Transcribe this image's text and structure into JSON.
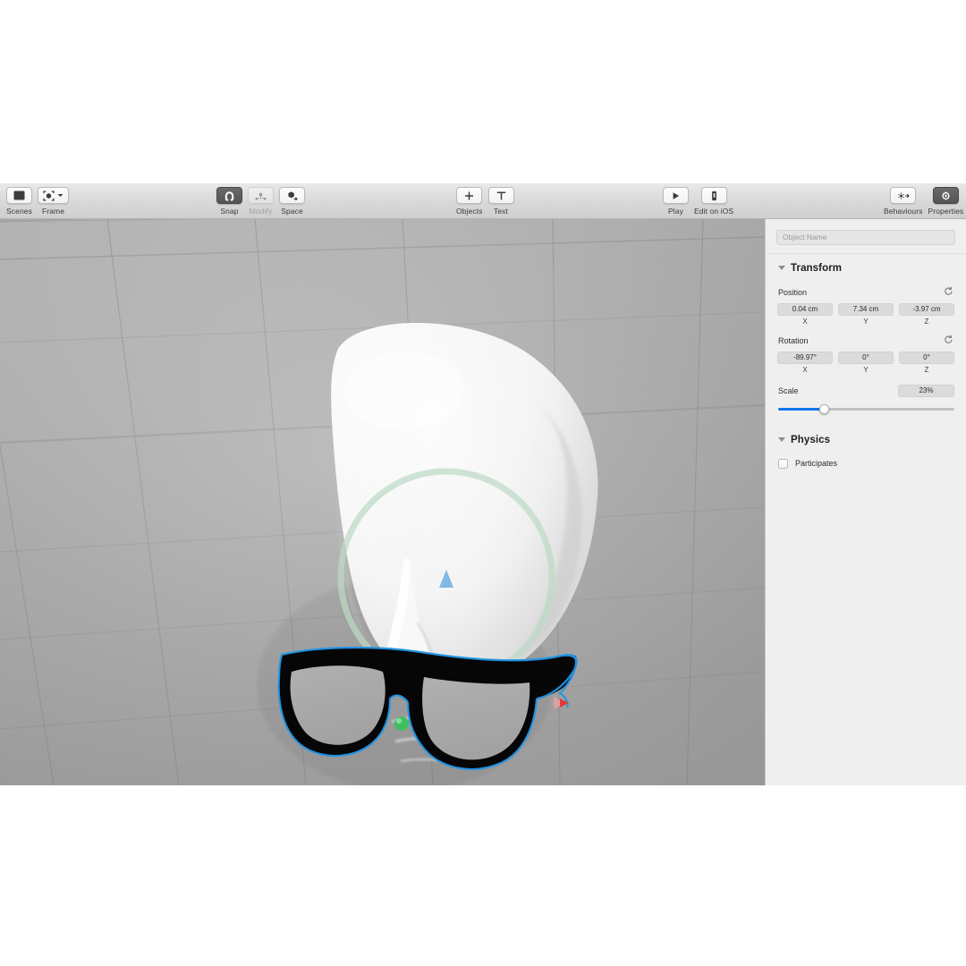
{
  "toolbar": {
    "groups": [
      {
        "name": "left",
        "items": [
          {
            "label": "Scenes",
            "icon": "scenes-panel-icon",
            "state": "normal",
            "dropdown": false
          },
          {
            "label": "Frame",
            "icon": "frame-object-icon",
            "state": "normal",
            "dropdown": true
          }
        ]
      },
      {
        "name": "transform",
        "items": [
          {
            "label": "Snap",
            "icon": "magnet-icon",
            "state": "active",
            "dropdown": false
          },
          {
            "label": "Modify",
            "icon": "modify-points-icon",
            "state": "disabled",
            "dropdown": false
          },
          {
            "label": "Space",
            "icon": "space-axis-icon",
            "state": "normal",
            "dropdown": false
          }
        ]
      },
      {
        "name": "create",
        "items": [
          {
            "label": "Objects",
            "icon": "plus-icon",
            "state": "normal",
            "dropdown": false
          },
          {
            "label": "Text",
            "icon": "text-t-icon",
            "state": "normal",
            "dropdown": false
          }
        ]
      },
      {
        "name": "play",
        "items": [
          {
            "label": "Play",
            "icon": "play-triangle-icon",
            "state": "normal",
            "dropdown": false
          },
          {
            "label": "Edit on iOS",
            "icon": "iphone-device-icon",
            "state": "normal",
            "dropdown": false
          }
        ]
      },
      {
        "name": "right",
        "items": [
          {
            "label": "Behaviours",
            "icon": "behaviours-burst-icon",
            "state": "normal",
            "dropdown": false
          },
          {
            "label": "Properties",
            "icon": "gear-icon",
            "state": "active",
            "dropdown": false
          }
        ]
      }
    ]
  },
  "viewport": {
    "background_color": "#b0b0b0",
    "grid_line_color": "#8e8e8e",
    "scene_objects": [
      {
        "name": "mask-head",
        "color": "#f4f4f4"
      },
      {
        "name": "sunglasses",
        "color": "#050505",
        "lens_color": "#a8a8a8"
      }
    ],
    "gizmo": {
      "selection_outline_color": "#2196e8",
      "rotation_ring_color": "#bcd9c6",
      "y_arrow_color": "#7fb9e4",
      "x_arrow_color": "#e34a4a",
      "center_handle_color": "#3fbf5f"
    }
  },
  "inspector": {
    "object_name_placeholder": "Object Name",
    "object_name_value": "",
    "sections": [
      {
        "key": "transform",
        "title": "Transform",
        "expanded": true
      },
      {
        "key": "physics",
        "title": "Physics",
        "expanded": true
      }
    ],
    "transform": {
      "position": {
        "label": "Position",
        "revert_icon": "revert-arrow-icon",
        "fields": [
          {
            "axis": "X",
            "value": "0.04 cm"
          },
          {
            "axis": "Y",
            "value": "7.34 cm"
          },
          {
            "axis": "Z",
            "value": "-3.97 cm"
          }
        ]
      },
      "rotation": {
        "label": "Rotation",
        "revert_icon": "revert-arrow-icon",
        "fields": [
          {
            "axis": "X",
            "value": "-89.97°"
          },
          {
            "axis": "Y",
            "value": "0°"
          },
          {
            "axis": "Z",
            "value": "0°"
          }
        ]
      },
      "scale": {
        "label": "Scale",
        "value": "23%",
        "slider_percent": 26,
        "fill_color": "#1276ea"
      }
    },
    "physics": {
      "participates_label": "Participates",
      "participates_checked": false
    }
  }
}
